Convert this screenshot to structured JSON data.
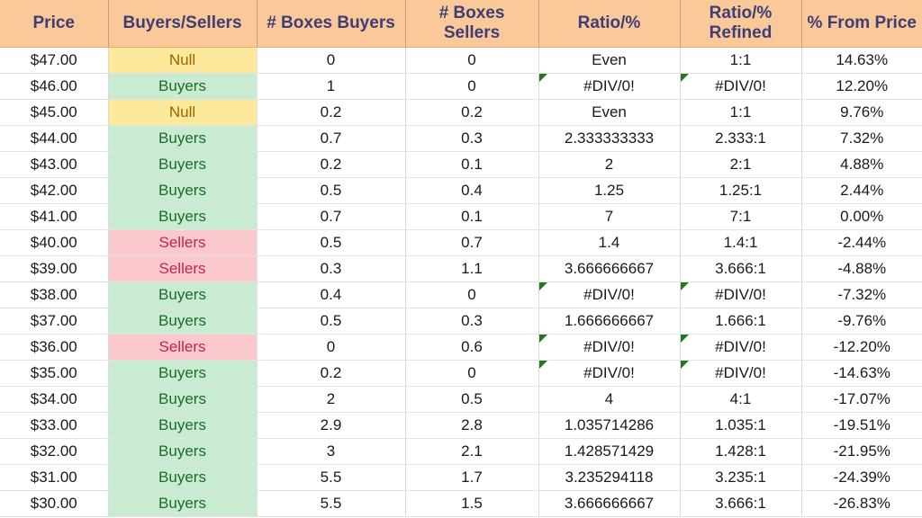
{
  "table": {
    "headers": [
      "Price",
      "Buyers/Sellers",
      "# Boxes Buyers",
      "# Boxes Sellers",
      "Ratio/%",
      "Ratio/%\nRefined",
      "% From Price"
    ],
    "header_lines": {
      "ratio_refined_line1": "Ratio/%",
      "ratio_refined_line2": "Refined"
    },
    "colors": {
      "header_bg": "#F9C99A",
      "header_text": "#3F3D73",
      "buyers_bg": "#C9EBD1",
      "buyers_text": "#1E6B28",
      "sellers_bg": "#FBC8CE",
      "sellers_text": "#C0254C",
      "null_bg": "#FDE99B",
      "null_text": "#9C6500",
      "error_triangle": "#217821",
      "grid_line": "#E3E3E3",
      "cell_text": "#1A1A1A"
    },
    "rows": [
      {
        "price": "$47.00",
        "side": "Null",
        "side_kind": "null",
        "boxes_buyers": "0",
        "boxes_sellers": "0",
        "ratio": "Even",
        "ratio_error": false,
        "ratio_refined": "1:1",
        "ratio_refined_error": false,
        "pct_from_price": "14.63%"
      },
      {
        "price": "$46.00",
        "side": "Buyers",
        "side_kind": "buyers",
        "boxes_buyers": "1",
        "boxes_sellers": "0",
        "ratio": "#DIV/0!",
        "ratio_error": true,
        "ratio_refined": "#DIV/0!",
        "ratio_refined_error": true,
        "pct_from_price": "12.20%"
      },
      {
        "price": "$45.00",
        "side": "Null",
        "side_kind": "null",
        "boxes_buyers": "0.2",
        "boxes_sellers": "0.2",
        "ratio": "Even",
        "ratio_error": false,
        "ratio_refined": "1:1",
        "ratio_refined_error": false,
        "pct_from_price": "9.76%"
      },
      {
        "price": "$44.00",
        "side": "Buyers",
        "side_kind": "buyers",
        "boxes_buyers": "0.7",
        "boxes_sellers": "0.3",
        "ratio": "2.333333333",
        "ratio_error": false,
        "ratio_refined": "2.333:1",
        "ratio_refined_error": false,
        "pct_from_price": "7.32%"
      },
      {
        "price": "$43.00",
        "side": "Buyers",
        "side_kind": "buyers",
        "boxes_buyers": "0.2",
        "boxes_sellers": "0.1",
        "ratio": "2",
        "ratio_error": false,
        "ratio_refined": "2:1",
        "ratio_refined_error": false,
        "pct_from_price": "4.88%"
      },
      {
        "price": "$42.00",
        "side": "Buyers",
        "side_kind": "buyers",
        "boxes_buyers": "0.5",
        "boxes_sellers": "0.4",
        "ratio": "1.25",
        "ratio_error": false,
        "ratio_refined": "1.25:1",
        "ratio_refined_error": false,
        "pct_from_price": "2.44%"
      },
      {
        "price": "$41.00",
        "side": "Buyers",
        "side_kind": "buyers",
        "boxes_buyers": "0.7",
        "boxes_sellers": "0.1",
        "ratio": "7",
        "ratio_error": false,
        "ratio_refined": "7:1",
        "ratio_refined_error": false,
        "pct_from_price": "0.00%"
      },
      {
        "price": "$40.00",
        "side": "Sellers",
        "side_kind": "sellers",
        "boxes_buyers": "0.5",
        "boxes_sellers": "0.7",
        "ratio": "1.4",
        "ratio_error": false,
        "ratio_refined": "1.4:1",
        "ratio_refined_error": false,
        "pct_from_price": "-2.44%"
      },
      {
        "price": "$39.00",
        "side": "Sellers",
        "side_kind": "sellers",
        "boxes_buyers": "0.3",
        "boxes_sellers": "1.1",
        "ratio": "3.666666667",
        "ratio_error": false,
        "ratio_refined": "3.666:1",
        "ratio_refined_error": false,
        "pct_from_price": "-4.88%"
      },
      {
        "price": "$38.00",
        "side": "Buyers",
        "side_kind": "buyers",
        "boxes_buyers": "0.4",
        "boxes_sellers": "0",
        "ratio": "#DIV/0!",
        "ratio_error": true,
        "ratio_refined": "#DIV/0!",
        "ratio_refined_error": true,
        "pct_from_price": "-7.32%"
      },
      {
        "price": "$37.00",
        "side": "Buyers",
        "side_kind": "buyers",
        "boxes_buyers": "0.5",
        "boxes_sellers": "0.3",
        "ratio": "1.666666667",
        "ratio_error": false,
        "ratio_refined": "1.666:1",
        "ratio_refined_error": false,
        "pct_from_price": "-9.76%"
      },
      {
        "price": "$36.00",
        "side": "Sellers",
        "side_kind": "sellers",
        "boxes_buyers": "0",
        "boxes_sellers": "0.6",
        "ratio": "#DIV/0!",
        "ratio_error": true,
        "ratio_refined": "#DIV/0!",
        "ratio_refined_error": true,
        "pct_from_price": "-12.20%"
      },
      {
        "price": "$35.00",
        "side": "Buyers",
        "side_kind": "buyers",
        "boxes_buyers": "0.2",
        "boxes_sellers": "0",
        "ratio": "#DIV/0!",
        "ratio_error": true,
        "ratio_refined": "#DIV/0!",
        "ratio_refined_error": true,
        "pct_from_price": "-14.63%"
      },
      {
        "price": "$34.00",
        "side": "Buyers",
        "side_kind": "buyers",
        "boxes_buyers": "2",
        "boxes_sellers": "0.5",
        "ratio": "4",
        "ratio_error": false,
        "ratio_refined": "4:1",
        "ratio_refined_error": false,
        "pct_from_price": "-17.07%"
      },
      {
        "price": "$33.00",
        "side": "Buyers",
        "side_kind": "buyers",
        "boxes_buyers": "2.9",
        "boxes_sellers": "2.8",
        "ratio": "1.035714286",
        "ratio_error": false,
        "ratio_refined": "1.035:1",
        "ratio_refined_error": false,
        "pct_from_price": "-19.51%"
      },
      {
        "price": "$32.00",
        "side": "Buyers",
        "side_kind": "buyers",
        "boxes_buyers": "3",
        "boxes_sellers": "2.1",
        "ratio": "1.428571429",
        "ratio_error": false,
        "ratio_refined": "1.428:1",
        "ratio_refined_error": false,
        "pct_from_price": "-21.95%"
      },
      {
        "price": "$31.00",
        "side": "Buyers",
        "side_kind": "buyers",
        "boxes_buyers": "5.5",
        "boxes_sellers": "1.7",
        "ratio": "3.235294118",
        "ratio_error": false,
        "ratio_refined": "3.235:1",
        "ratio_refined_error": false,
        "pct_from_price": "-24.39%"
      },
      {
        "price": "$30.00",
        "side": "Buyers",
        "side_kind": "buyers",
        "boxes_buyers": "5.5",
        "boxes_sellers": "1.5",
        "ratio": "3.666666667",
        "ratio_error": false,
        "ratio_refined": "3.666:1",
        "ratio_refined_error": false,
        "pct_from_price": "-26.83%"
      }
    ]
  }
}
